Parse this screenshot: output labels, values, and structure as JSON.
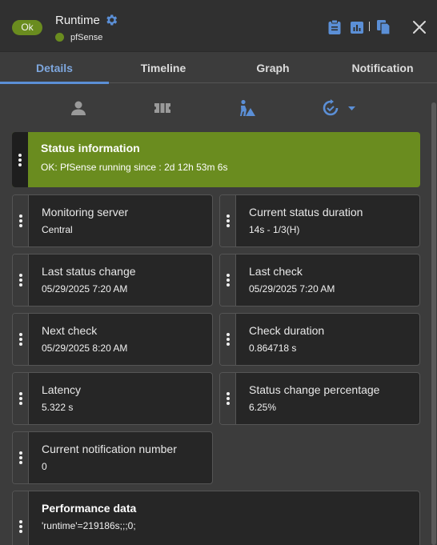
{
  "header": {
    "status_badge": "Ok",
    "title": "Runtime",
    "host": "pfSense",
    "icons": [
      "gear-icon",
      "clipboard-icon",
      "bar-chart-icon",
      "copy-icon",
      "close-icon"
    ]
  },
  "tabs": [
    {
      "label": "Details",
      "active": true
    },
    {
      "label": "Timeline",
      "active": false
    },
    {
      "label": "Graph",
      "active": false
    },
    {
      "label": "Notification",
      "active": false
    }
  ],
  "toolbar": [
    "user-icon",
    "ticket-icon",
    "acknowledge-icon",
    "refresh-check-icon"
  ],
  "status": {
    "title": "Status information",
    "value": "OK: PfSense running since : 2d 12h 53m 6s"
  },
  "details": {
    "monitoring_server": {
      "title": "Monitoring server",
      "value": "Central"
    },
    "current_status_duration": {
      "title": "Current status duration",
      "value": "14s - 1/3(H)"
    },
    "last_status_change": {
      "title": "Last status change",
      "value": "05/29/2025 7:20 AM"
    },
    "last_check": {
      "title": "Last check",
      "value": "05/29/2025 7:20 AM"
    },
    "next_check": {
      "title": "Next check",
      "value": "05/29/2025 8:20 AM"
    },
    "check_duration": {
      "title": "Check duration",
      "value": "0.864718 s"
    },
    "latency": {
      "title": "Latency",
      "value": "5.322 s"
    },
    "status_change_percentage": {
      "title": "Status change percentage",
      "value": "6.25%"
    },
    "current_notification_number": {
      "title": "Current notification number",
      "value": "0"
    }
  },
  "performance": {
    "title": "Performance data",
    "value": "'runtime'=219186s;;;0;"
  },
  "colors": {
    "ok": "#6a8c1f",
    "accent": "#5b8fd6",
    "background": "#3c3c3c",
    "card": "#262626"
  }
}
